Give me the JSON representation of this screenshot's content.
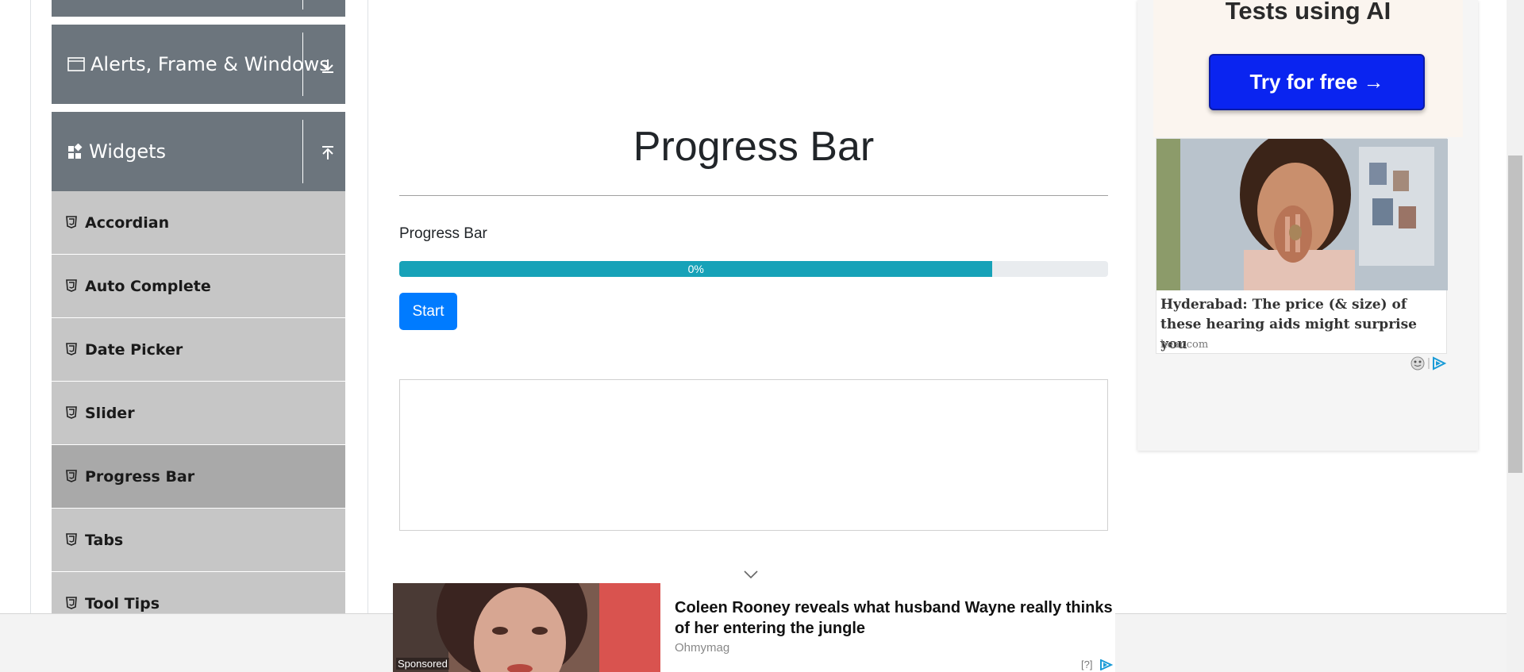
{
  "sidebar": {
    "groups": [
      {
        "label": "Alerts, Frame & Windows",
        "icon": "window-icon",
        "state": "collapsed"
      },
      {
        "label": "Widgets",
        "icon": "widgets-icon",
        "state": "expanded"
      }
    ],
    "items": [
      {
        "label": "Accordian",
        "active": false
      },
      {
        "label": "Auto Complete",
        "active": false
      },
      {
        "label": "Date Picker",
        "active": false
      },
      {
        "label": "Slider",
        "active": false
      },
      {
        "label": "Progress Bar",
        "active": true
      },
      {
        "label": "Tabs",
        "active": false
      },
      {
        "label": "Tool Tips",
        "active": false
      }
    ]
  },
  "main": {
    "title": "Progress Bar",
    "progress_label": "Progress Bar",
    "progress_text": "0%",
    "progress_fill": 0.837,
    "start_label": "Start"
  },
  "right_ad": {
    "heading": "Tests using AI",
    "button_label": "Try for free →",
    "headline": "Hyderabad: The price (& size) of these hearing aids might surprise you",
    "source": "hear.com"
  },
  "bottom_ad": {
    "sponsored": "Sponsored",
    "headline": "Coleen Rooney reveals what husband Wayne really thinks of her entering the jungle",
    "source": "Ohmymag",
    "help": "[?]"
  },
  "colors": {
    "sidebar_header": "#6c757d",
    "menu_item": "#c6c6c6",
    "menu_item_active": "#a9a9a9",
    "progress_fill": "#17a2b8",
    "progress_track": "#e9ecef",
    "primary_button": "#007bff",
    "ad_button": "#0a24f0"
  }
}
